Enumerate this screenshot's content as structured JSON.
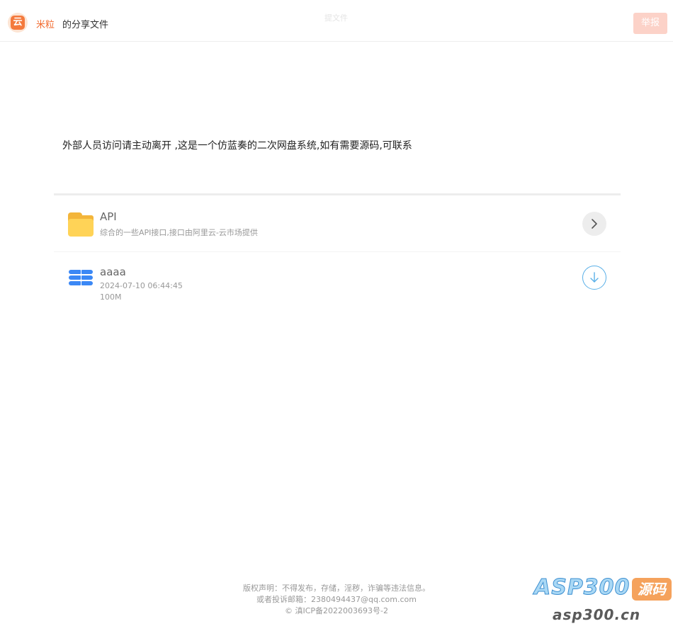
{
  "header": {
    "logo_char": "云",
    "username": "米粒",
    "title_suffix": "的分享文件",
    "center_title": "提文件",
    "report_label": "举报"
  },
  "description": "外部人员访问请主动离开 ,这是一个仿蓝奏的二次网盘系统,如有需要源码,可联系",
  "items": [
    {
      "type": "folder",
      "name": "API",
      "note": "综合的一些API接口,接口由阿里云-云市场提供",
      "icon": "folder-icon",
      "action_icon": "chevron-right-icon"
    },
    {
      "type": "file",
      "name": "aaaa",
      "date": "2024-07-10 06:44:45",
      "size": "100M",
      "icon": "database-icon",
      "action_icon": "download-icon"
    }
  ],
  "footer": {
    "line1": "版权声明：不得发布，存储，淫秽，诈骗等违法信息。",
    "line2": "或者投诉邮箱：2380494437@qq.com.com",
    "line3": "© 滇ICP备2022003693号-2"
  },
  "watermark": {
    "brand": "ASP300",
    "tag": "源码",
    "url": "asp300.cn"
  },
  "colors": {
    "accent": "#f26a2e",
    "report_bg": "#fcd2c8",
    "folder": "#ffd357",
    "file_icon": "#3b88f5",
    "download": "#5ab0e8"
  }
}
